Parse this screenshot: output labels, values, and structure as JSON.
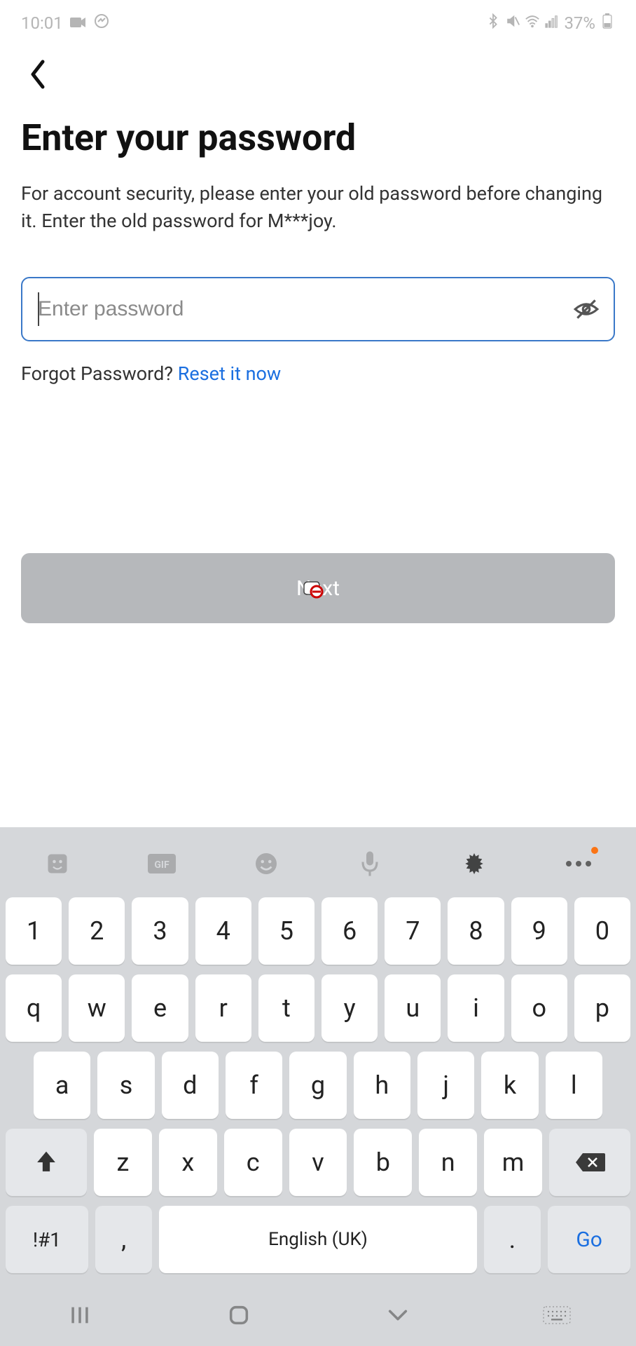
{
  "status": {
    "time": "10:01",
    "battery": "37%"
  },
  "header": {
    "title": "Enter your password",
    "subtitle": "For account security, please enter your old password before changing it. Enter the old password for M***joy."
  },
  "password_field": {
    "placeholder": "Enter password",
    "value": ""
  },
  "forgot": {
    "label": "Forgot Password? ",
    "link": "Reset it now"
  },
  "next_button": "Next",
  "keyboard": {
    "rows": {
      "r1": [
        "1",
        "2",
        "3",
        "4",
        "5",
        "6",
        "7",
        "8",
        "9",
        "0"
      ],
      "r2": [
        "q",
        "w",
        "e",
        "r",
        "t",
        "y",
        "u",
        "i",
        "o",
        "p"
      ],
      "r3": [
        "a",
        "s",
        "d",
        "f",
        "g",
        "h",
        "j",
        "k",
        "l"
      ],
      "r4": [
        "z",
        "x",
        "c",
        "v",
        "b",
        "n",
        "m"
      ]
    },
    "sym": "!#1",
    "comma": ",",
    "space_label": "English (UK)",
    "period": ".",
    "go": "Go"
  }
}
